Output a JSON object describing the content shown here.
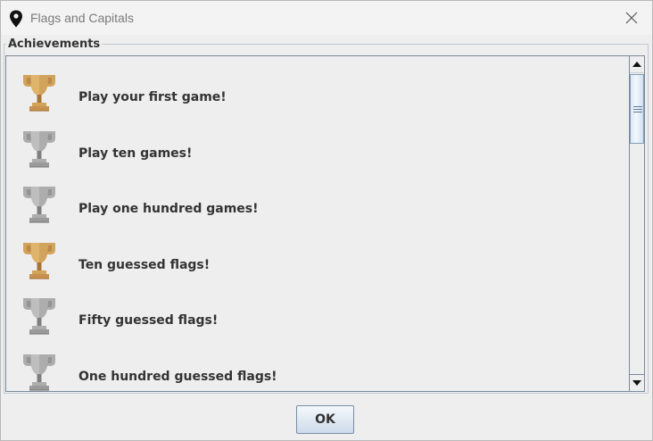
{
  "window": {
    "title": "Flags and Capitals",
    "app_icon": "map-pin-icon",
    "close_icon": "close-icon"
  },
  "achievements": {
    "group_title": "Achievements",
    "items": [
      {
        "label": "Play your first game!",
        "trophy": "gold"
      },
      {
        "label": "Play ten games!",
        "trophy": "silver"
      },
      {
        "label": "Play one hundred games!",
        "trophy": "silver"
      },
      {
        "label": "Ten guessed flags!",
        "trophy": "gold"
      },
      {
        "label": "Fifty guessed flags!",
        "trophy": "silver"
      },
      {
        "label": "One hundred guessed flags!",
        "trophy": "silver"
      }
    ]
  },
  "footer": {
    "ok_label": "OK"
  },
  "colors": {
    "gold_trophy": "#d2a35b",
    "silver_trophy": "#a9a9a9",
    "text": "#333333",
    "background": "#eeeeee"
  }
}
